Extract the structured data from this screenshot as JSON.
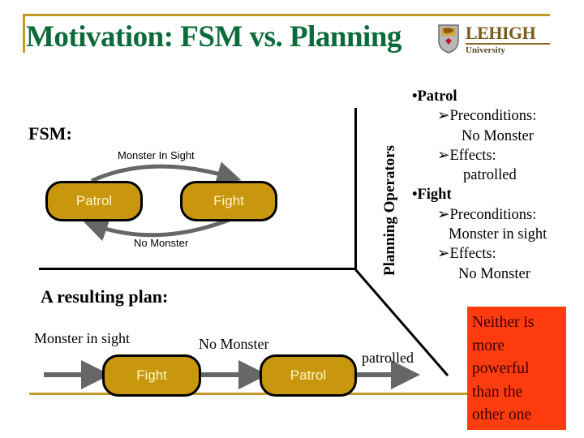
{
  "slide": {
    "title": "Motivation: FSM vs. Planning",
    "logo": {
      "name": "LEHIGH",
      "subtitle": "University",
      "icon": "shield-icon"
    },
    "colors": {
      "title": "#0b6b3a",
      "rule": "#c49a2a",
      "state_fill": "#c9970e",
      "state_text": "#fff6c8",
      "arrow": "#666666",
      "callout": "#ff3c0f"
    }
  },
  "fsm": {
    "label": "FSM:",
    "states": [
      "Patrol",
      "Fight"
    ],
    "transitions": [
      {
        "from": "Patrol",
        "to": "Fight",
        "label": "Monster In Sight"
      },
      {
        "from": "Fight",
        "to": "Patrol",
        "label": "No Monster"
      }
    ]
  },
  "planning": {
    "label": "Planning Operators",
    "operators": [
      {
        "name": "•Patrol",
        "precond_label": "➢Preconditions:",
        "precond": "No Monster",
        "effects_label": "➢Effects:",
        "effects": "patrolled"
      },
      {
        "name": "•Fight",
        "precond_label": "➢Preconditions:",
        "precond": "Monster in sight",
        "effects_label": "➢Effects:",
        "effects": "No Monster"
      }
    ]
  },
  "plan": {
    "label": "A resulting plan:",
    "steps": [
      "Fight",
      "Patrol"
    ],
    "conditions": [
      "Monster in sight",
      "No Monster",
      "patrolled"
    ]
  },
  "callout": {
    "lines": [
      "Neither is",
      "more",
      "powerful",
      "than the",
      "other one"
    ]
  }
}
